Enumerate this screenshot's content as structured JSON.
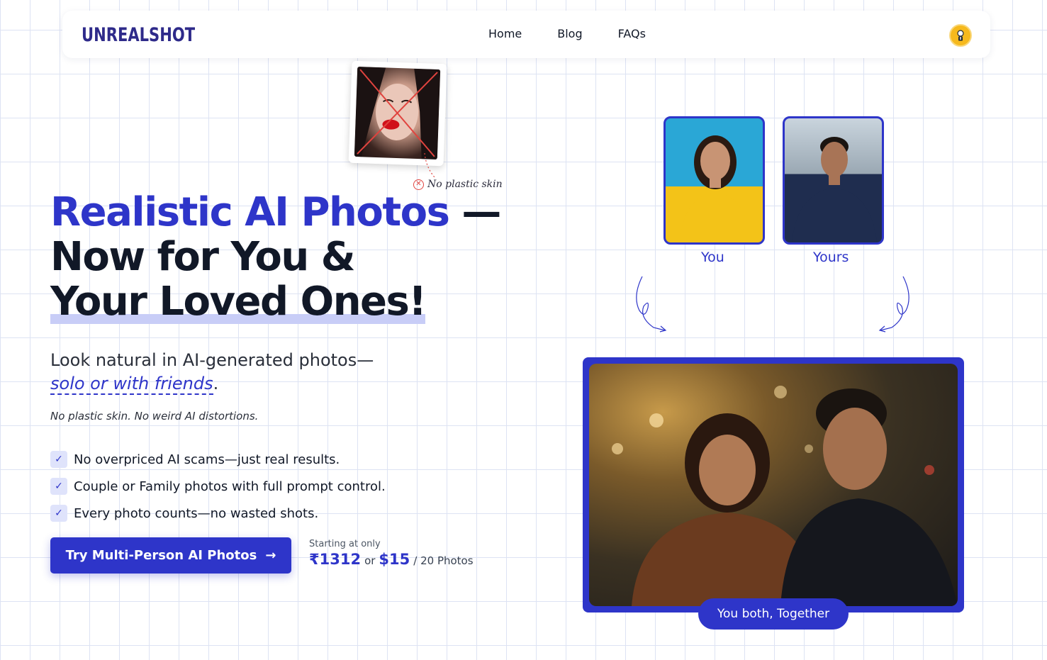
{
  "brand": {
    "logo_text": "UNREALSHOT"
  },
  "nav": {
    "items": [
      {
        "label": "Home"
      },
      {
        "label": "Blog"
      },
      {
        "label": "FAQs"
      }
    ]
  },
  "polaroid": {
    "note": "No plastic skin"
  },
  "hero": {
    "title_accent": "Realistic AI Photos",
    "title_dash": " —",
    "title_line2": "Now for You &",
    "title_line3": "Your Loved Ones!",
    "subtitle_main": "Look natural in AI-generated photos—",
    "subtitle_highlight": "solo or with friends",
    "subtitle_end": ".",
    "tagline": "No plastic skin. No weird AI distortions."
  },
  "features": [
    {
      "text": "No overpriced AI scams—just real results."
    },
    {
      "text": "Couple or Family photos with full prompt control."
    },
    {
      "text": "Every photo counts—no wasted shots."
    }
  ],
  "cta": {
    "label": "Try Multi-Person AI Photos",
    "arrow": "→"
  },
  "pricing": {
    "label": "Starting at only",
    "inr": "₹1312",
    "or": "or",
    "usd": "$15",
    "per": "/ 20 Photos"
  },
  "showcase": {
    "you_label": "You",
    "yours_label": "Yours",
    "together_caption": "You both, Together"
  },
  "colors": {
    "accent": "#2e35c9",
    "avatar": "#f6b91d"
  }
}
